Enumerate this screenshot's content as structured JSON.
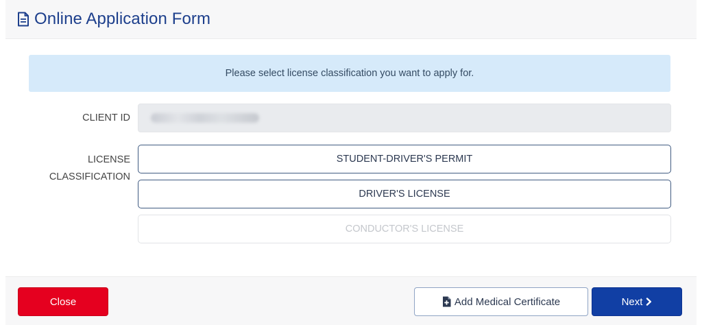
{
  "header": {
    "title": "Online Application Form",
    "icon": "document-icon"
  },
  "notice": {
    "text": "Please select license classification you want to apply for."
  },
  "form": {
    "client_id_label": "CLIENT ID",
    "license_label_line1": "LICENSE",
    "license_label_line2": "CLASSIFICATION",
    "options": [
      {
        "label": "STUDENT-DRIVER'S PERMIT",
        "enabled": true
      },
      {
        "label": "DRIVER'S LICENSE",
        "enabled": true
      },
      {
        "label": "CONDUCTOR'S LICENSE",
        "enabled": false
      }
    ]
  },
  "footer": {
    "close_label": "Close",
    "medical_label": "Add Medical Certificate",
    "next_label": "Next"
  },
  "colors": {
    "title": "#1d3f8c",
    "notice_bg": "#d6eafa",
    "close_bg": "#e5001f",
    "next_bg": "#113fa4",
    "option_border": "#3f5a80"
  }
}
